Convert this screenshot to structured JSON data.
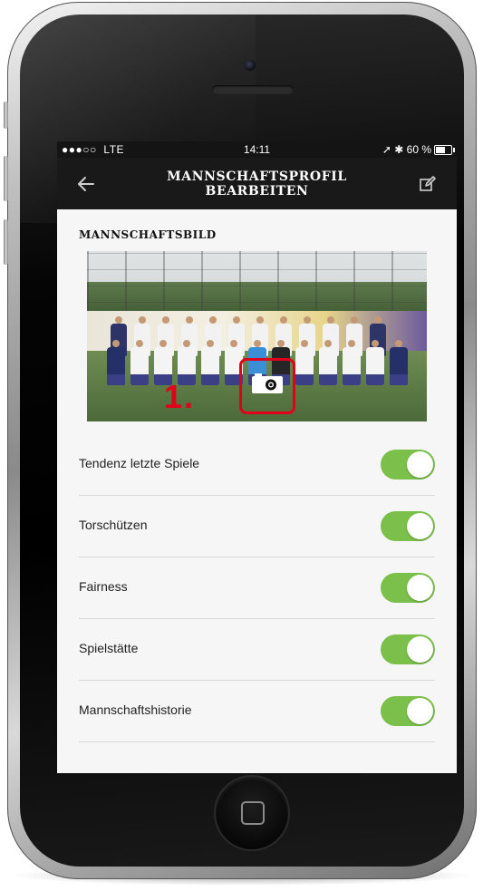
{
  "status_bar": {
    "signal": "●●●○○",
    "carrier": "LTE",
    "time": "14:11",
    "battery_text": "60 %",
    "battery_level": 0.6
  },
  "nav": {
    "title_line1": "MANNSCHAFTSPROFIL",
    "title_line2": "BEARBEITEN",
    "back_icon": "arrow-left-icon",
    "edit_icon": "edit-icon"
  },
  "section": {
    "title": "MANNSCHAFTSBILD"
  },
  "photo": {
    "camera_icon": "camera-icon",
    "step_label": "1."
  },
  "toggles": [
    {
      "label": "Tendenz letzte Spiele",
      "on": true
    },
    {
      "label": "Torschützen",
      "on": true
    },
    {
      "label": "Fairness",
      "on": true
    },
    {
      "label": "Spielstätte",
      "on": true
    },
    {
      "label": "Mannschaftshistorie",
      "on": true
    }
  ],
  "colors": {
    "toggle_on": "#7cc04c",
    "highlight": "#e0001a",
    "nav_bg": "#191919"
  }
}
